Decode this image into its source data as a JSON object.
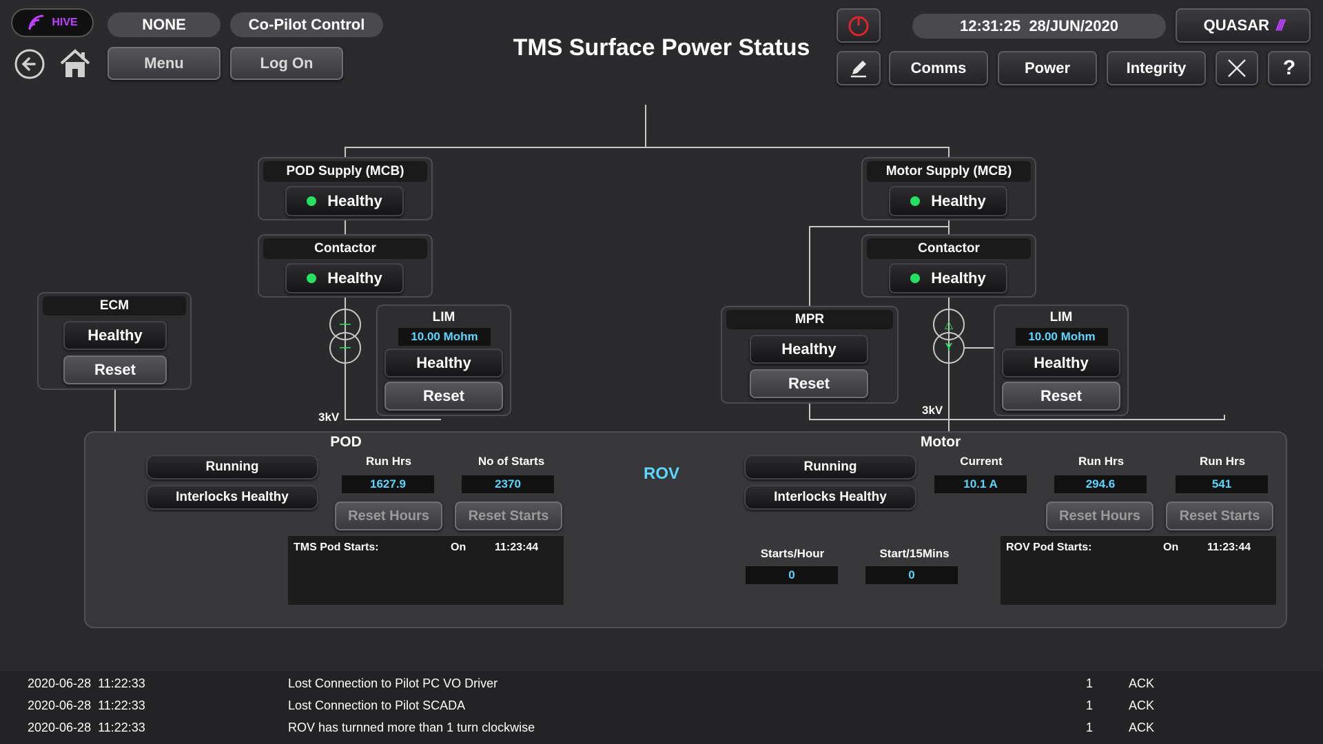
{
  "header": {
    "logo_text": "HIVE",
    "user_pill": "NONE",
    "control_pill": "Co-Pilot Control",
    "menu_label": "Menu",
    "logon_label": "Log On",
    "title": "TMS Surface Power Status",
    "datetime": "12:31:25  28/JUN/2020",
    "brand": "QUASAR",
    "nav": {
      "comms": "Comms",
      "power": "Power",
      "integrity": "Integrity",
      "help": "?"
    }
  },
  "pod_supply": {
    "title": "POD Supply (MCB)",
    "status": "Healthy"
  },
  "pod_contactor": {
    "title": "Contactor",
    "status": "Healthy"
  },
  "motor_supply": {
    "title": "Motor Supply (MCB)",
    "status": "Healthy"
  },
  "motor_contactor": {
    "title": "Contactor",
    "status": "Healthy"
  },
  "ecm": {
    "title": "ECM",
    "status": "Healthy",
    "reset": "Reset"
  },
  "pod_lim": {
    "title": "LIM",
    "value": "10.00 Mohm",
    "status": "Healthy",
    "reset": "Reset"
  },
  "motor_lim": {
    "title": "LIM",
    "value": "10.00 Mohm",
    "status": "Healthy",
    "reset": "Reset"
  },
  "mpr": {
    "title": "MPR",
    "status": "Healthy",
    "reset": "Reset"
  },
  "voltage_pod": "3kV",
  "voltage_motor": "3kV",
  "pod_panel": {
    "title": "POD",
    "running": "Running",
    "interlocks": "Interlocks Healthy",
    "run_hrs_label": "Run Hrs",
    "run_hrs": "1627.9",
    "starts_label": "No of Starts",
    "starts": "2370",
    "reset_hours": "Reset Hours",
    "reset_starts": "Reset Starts",
    "log_label": "TMS Pod Starts:",
    "log_state": "On",
    "log_time": "11:23:44"
  },
  "rov_label": "ROV",
  "motor_panel": {
    "title": "Motor",
    "running": "Running",
    "interlocks": "Interlocks Healthy",
    "current_label": "Current",
    "current": "10.1 A",
    "run_hrs_label": "Run Hrs",
    "run_hrs": "294.6",
    "run_hrs2_label": "Run Hrs",
    "run_hrs2": "541",
    "reset_hours": "Reset Hours",
    "reset_starts": "Reset Starts",
    "starts_hour_label": "Starts/Hour",
    "starts_hour": "0",
    "starts_15_label": "Start/15Mins",
    "starts_15": "0",
    "log_label": "ROV Pod Starts:",
    "log_state": "On",
    "log_time": "11:23:44"
  },
  "alarms": [
    {
      "time": "2020-06-28  11:22:33",
      "message": "Lost Connection to Pilot PC VO Driver",
      "count": "1",
      "ack": "ACK"
    },
    {
      "time": "2020-06-28  11:22:33",
      "message": "Lost Connection to Pilot SCADA",
      "count": "1",
      "ack": "ACK"
    },
    {
      "time": "2020-06-28  11:22:33",
      "message": "ROV has turnned more than 1 turn clockwise",
      "count": "1",
      "ack": "ACK"
    }
  ],
  "colors": {
    "healthy": "#27e05c",
    "value": "#5bd6ff",
    "alert": "#e0242a",
    "hive": "#c040ff"
  }
}
